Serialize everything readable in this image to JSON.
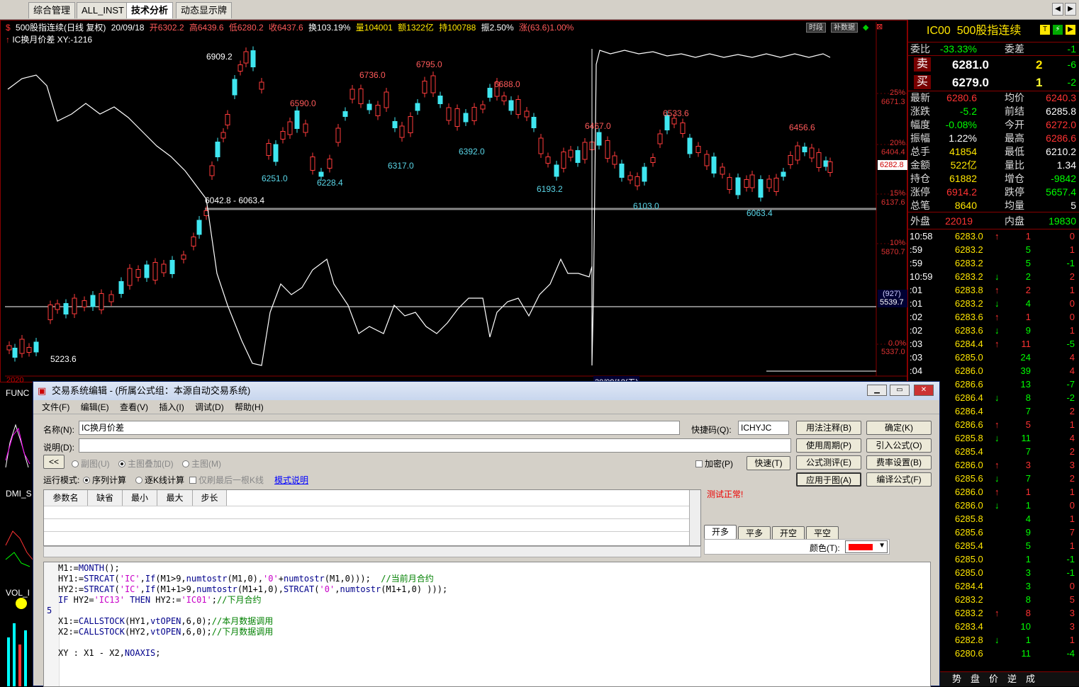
{
  "tabs": [
    "综合管理",
    "ALL_INST",
    "技术分析",
    "动态显示牌"
  ],
  "chart": {
    "info": {
      "name": "500股指连续(日线 复权)",
      "date": "20/09/18",
      "open": "开6302.2",
      "high": "高6439.6",
      "low": "低6280.2",
      "close": "收6437.6",
      "turnover": "换103.19%",
      "volume": "量104001",
      "amount": "额1322亿",
      "hold": "持100788",
      "amplitude": "振2.50%",
      "change": "涨(63.6)1.00%"
    },
    "indicator_label": "IC换月价差 XY:-1216",
    "buttons": [
      "时段",
      "补数据"
    ],
    "price_labels": [
      "6909.2",
      "6736.0",
      "6795.0",
      "6590.0",
      "6688.0",
      "6251.0",
      "6228.4",
      "6317.0",
      "6392.0",
      "6467.0",
      "6533.6",
      "6193.2",
      "6456.6",
      "6103.0",
      "6063.4",
      "5223.6",
      "5223.6"
    ],
    "range_label": "6042.8 - 6063.4",
    "axis_pct": [
      "25%",
      "20%",
      "15%",
      "10%",
      "0.0%"
    ],
    "axis_price": [
      "6671.3",
      "6404.4",
      "6137.6",
      "5870.7",
      "5337.0"
    ],
    "cursor_price": "6282.8",
    "cursor_ind": "(927)",
    "cursor_ind_price": "5539.7",
    "x_start": "2020",
    "x_cursor": "20/09/18(五)"
  },
  "quote": {
    "code": "IC00",
    "name": "500股指连续",
    "weibi_label": "委比",
    "weibi": "-33.33%",
    "weicha_label": "委差",
    "weicha": "-1",
    "sell_label": "卖",
    "sell_price": "6281.0",
    "sell_vol": "2",
    "sell_chg": "-6",
    "buy_label": "买",
    "buy_price": "6279.0",
    "buy_vol": "1",
    "buy_chg": "-2",
    "rows": [
      [
        "最新",
        "6280.6",
        "均价",
        "6240.3"
      ],
      [
        "涨跌",
        "-5.2",
        "前结",
        "6285.8"
      ],
      [
        "幅度",
        "-0.08%",
        "今开",
        "6272.0"
      ],
      [
        "振幅",
        "1.22%",
        "最高",
        "6286.6"
      ],
      [
        "总手",
        "41854",
        "最低",
        "6210.2"
      ],
      [
        "金额",
        "522亿",
        "量比",
        "1.34"
      ],
      [
        "持仓",
        "61882",
        "增仓",
        "-9842"
      ],
      [
        "涨停",
        "6914.2",
        "跌停",
        "5657.4"
      ],
      [
        "总笔",
        "8640",
        "均量",
        "5"
      ]
    ],
    "outer_label": "外盘",
    "outer": "22019",
    "inner_label": "内盘",
    "inner": "19830",
    "ticks": [
      [
        "10:58",
        "6283.0",
        "↑",
        "1",
        "0"
      ],
      [
        ":59",
        "6283.2",
        "",
        "5",
        "1"
      ],
      [
        ":59",
        "6283.2",
        "",
        "5",
        "-1"
      ],
      [
        "10:59",
        "6283.2",
        "↓",
        "2",
        "2"
      ],
      [
        ":01",
        "6283.8",
        "↑",
        "2",
        "1"
      ],
      [
        ":01",
        "6283.2",
        "↓",
        "4",
        "0"
      ],
      [
        ":02",
        "6283.6",
        "↑",
        "1",
        "0"
      ],
      [
        ":02",
        "6283.6",
        "↓",
        "9",
        "1"
      ],
      [
        ":03",
        "6284.4",
        "↑",
        "11",
        "-5"
      ],
      [
        ":03",
        "6285.0",
        "",
        "24",
        "4"
      ],
      [
        ":04",
        "6286.0",
        "",
        "39",
        "4"
      ],
      [
        ":05",
        "6286.6",
        "",
        "13",
        "-7"
      ],
      [
        ":05",
        "6286.4",
        "↓",
        "8",
        "-2"
      ],
      [
        ":05",
        "6286.4",
        "",
        "7",
        "2"
      ],
      [
        ":05",
        "6286.6",
        "↑",
        "5",
        "1"
      ],
      [
        ":06",
        "6285.8",
        "↓",
        "11",
        "4"
      ],
      [
        ":06",
        "6285.4",
        "",
        "7",
        "2"
      ],
      [
        ":06",
        "6286.0",
        "↑",
        "3",
        "3"
      ],
      [
        ":06",
        "6285.6",
        "↓",
        "7",
        "2"
      ],
      [
        ":07",
        "6286.0",
        "↑",
        "1",
        "1"
      ],
      [
        ":07",
        "6286.0",
        "↓",
        "1",
        "0"
      ],
      [
        ":07",
        "6285.8",
        "",
        "4",
        "1"
      ],
      [
        ":07",
        "6285.6",
        "",
        "9",
        "7"
      ],
      [
        ":08",
        "6285.4",
        "",
        "5",
        "1"
      ],
      [
        ":08",
        "6285.0",
        "",
        "1",
        "-1"
      ],
      [
        ":08",
        "6285.0",
        "",
        "3",
        "-1"
      ],
      [
        ":08",
        "6284.4",
        "",
        "3",
        "0"
      ],
      [
        ":09",
        "6283.2",
        "",
        "8",
        "5"
      ],
      [
        ":09",
        "6283.2",
        "↑",
        "8",
        "3"
      ],
      [
        ":09",
        "6283.4",
        "",
        "10",
        "3"
      ],
      [
        ":09",
        "6282.8",
        "↓",
        "1",
        "1"
      ],
      [
        ":10",
        "6280.6",
        "",
        "11",
        "-4"
      ]
    ],
    "bottom_tabs": [
      "势",
      "盘",
      "价",
      "逆",
      "成"
    ]
  },
  "left_strip": [
    "FUNC",
    "DMI_S",
    "VOL_I"
  ],
  "dialog": {
    "title": "交易系统编辑 - (所属公式组：本源自动交易系统)",
    "menu": [
      "文件(F)",
      "编辑(E)",
      "查看(V)",
      "插入(I)",
      "调试(D)",
      "帮助(H)"
    ],
    "name_label": "名称(N):",
    "name_value": "IC换月价差",
    "shortcut_label": "快捷码(Q):",
    "shortcut_value": "ICHYJC",
    "desc_label": "说明(D):",
    "btn_usage": "用法注释(B)",
    "btn_ok": "确定(K)",
    "btn_period": "使用周期(P)",
    "btn_import": "引入公式(O)",
    "btn_eval": "公式测评(E)",
    "btn_fee": "费率设置(B)",
    "btn_apply": "应用于图(A)",
    "btn_compile": "编译公式(F)",
    "btn_collapse": "<<",
    "radio_sub": "副图(U)",
    "radio_overlay": "主图叠加(D)",
    "radio_main": "主图(M)",
    "chk_encrypt": "加密(P)",
    "btn_quick": "快速(T)",
    "mode_label": "运行模式:",
    "mode_seq": "序列计算",
    "mode_k": "逐K线计算",
    "mode_last": "仅刷最后一根K线",
    "mode_help": "模式说明",
    "param_headers": [
      "参数名",
      "缺省",
      "最小",
      "最大",
      "步长"
    ],
    "status": "测试正常!",
    "signal_tabs": [
      "开多",
      "平多",
      "开空",
      "平空"
    ],
    "color_label": "颜色(T):",
    "code_lines": [
      "M1:=MONTH();",
      "HY1:=STRCAT('IC',If(M1>9,numtostr(M1,0),'0'+numtostr(M1,0)));  //当前月合约",
      "HY2:=STRCAT('IC',If(M1+1>9,numtostr(M1+1,0),STRCAT('0',numtostr(M1+1,0) )));",
      "IF HY2='IC13' THEN HY2:='IC01';//下月合约",
      "",
      "X1:=CALLSTOCK(HY1,vtOPEN,6,0);//本月数据调用",
      "X2:=CALLSTOCK(HY2,vtOPEN,6,0);//下月数据调用",
      "",
      "XY : X1 - X2,NOAXIS;"
    ],
    "line_no": "5"
  }
}
